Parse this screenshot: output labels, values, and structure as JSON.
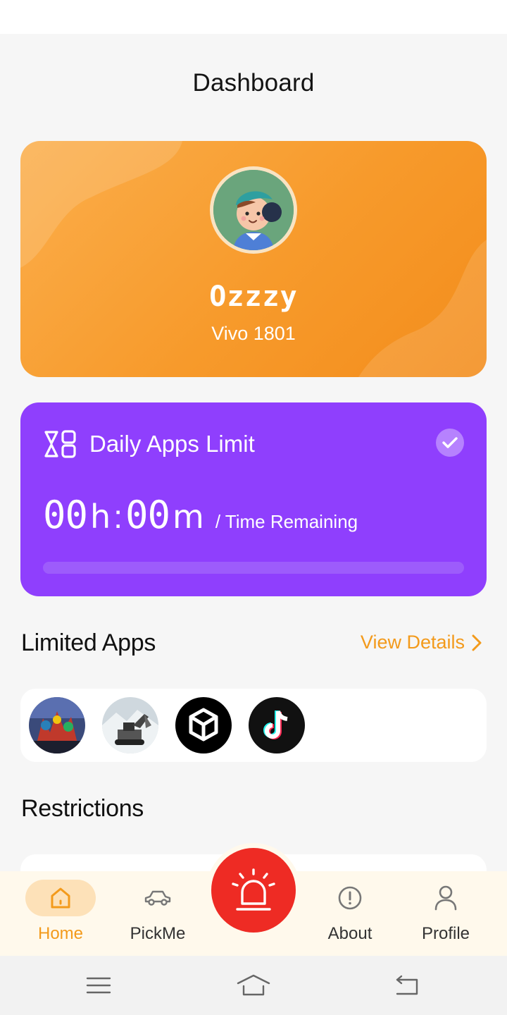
{
  "header": {
    "title": "Dashboard"
  },
  "profile": {
    "name": "Ozzzy",
    "device": "Vivo 1801"
  },
  "daily_limit": {
    "title": "Daily Apps Limit",
    "hours": "00",
    "hours_unit": "h",
    "separator": ":",
    "minutes": "00",
    "minutes_unit": "m",
    "remaining_label": "/ Time Remaining",
    "progress": 0,
    "enabled": true
  },
  "limited_apps": {
    "title": "Limited Apps",
    "view_details_label": "View Details",
    "apps": [
      {
        "icon": "game-app-icon"
      },
      {
        "icon": "excavator-game-icon"
      },
      {
        "icon": "unity-icon"
      },
      {
        "icon": "tiktok-icon"
      }
    ]
  },
  "restrictions": {
    "title": "Restrictions"
  },
  "bottom_nav": {
    "items": [
      {
        "label": "Home",
        "icon": "home-icon",
        "active": true
      },
      {
        "label": "PickMe",
        "icon": "car-icon",
        "active": false
      },
      {
        "label": "About",
        "icon": "info-icon",
        "active": false
      },
      {
        "label": "Profile",
        "icon": "user-icon",
        "active": false
      }
    ],
    "center_button_icon": "alarm-siren-icon"
  },
  "colors": {
    "accent": "#f39a1b",
    "profile_card": "#f79a2b",
    "limit_card": "#8f3ffd",
    "alarm": "#ee2b24",
    "nav_bg": "#fff9ec"
  }
}
